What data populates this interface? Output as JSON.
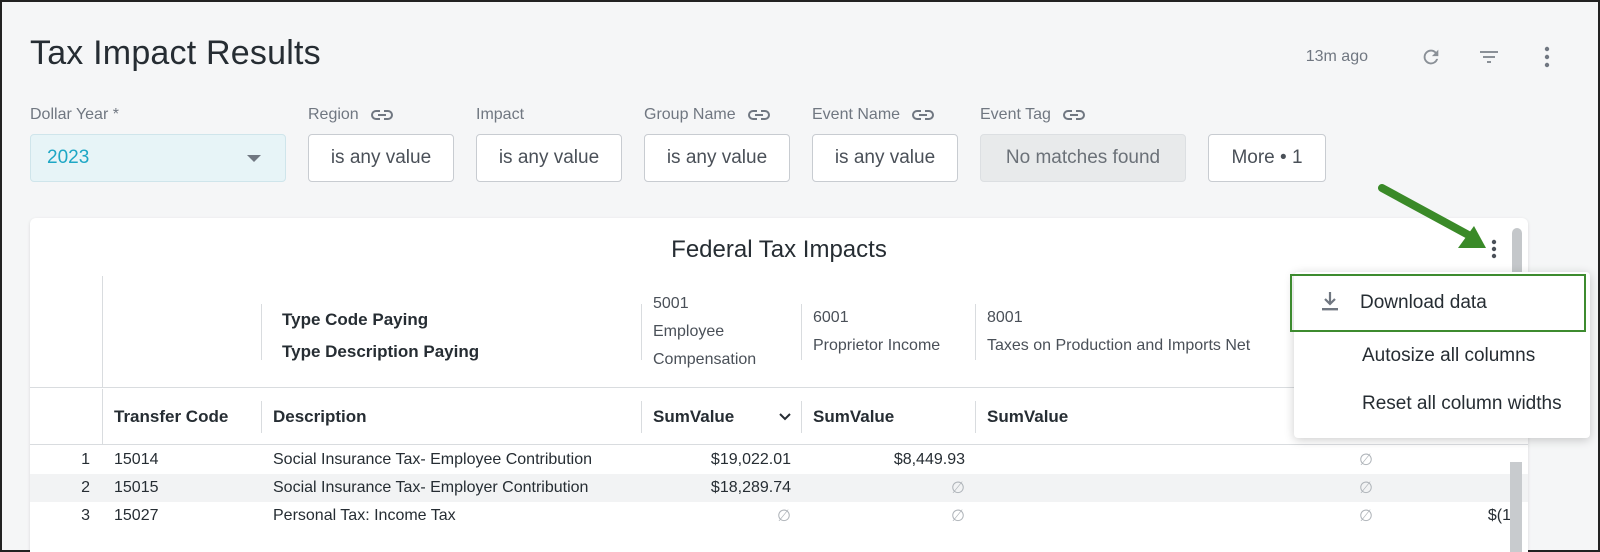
{
  "page": {
    "title": "Tax Impact Results",
    "updated": "13m ago",
    "icons": [
      "refresh-icon",
      "filter-icon",
      "more-vertical-icon"
    ]
  },
  "filters": {
    "dollar_year": {
      "label": "Dollar Year *",
      "value": "2023"
    },
    "region": {
      "label": "Region",
      "value": "is any value"
    },
    "impact": {
      "label": "Impact",
      "value": "is any value"
    },
    "group_name": {
      "label": "Group Name",
      "value": "is any value"
    },
    "event_name": {
      "label": "Event Name",
      "value": "is any value"
    },
    "event_tag": {
      "label": "Event Tag",
      "value": "No matches found"
    },
    "more": {
      "label": "More • 1"
    }
  },
  "card": {
    "title": "Federal Tax Impacts",
    "pivot": {
      "row_label_1": "Type Code Paying",
      "row_label_2": "Type Description Paying",
      "cols": [
        {
          "code": "5001",
          "desc1": "Employee",
          "desc2": "Compensation"
        },
        {
          "code": "6001",
          "desc": "Proprietor Income"
        },
        {
          "code": "8001",
          "desc": "Taxes on Production and Imports Net"
        }
      ]
    },
    "columns": {
      "transfer_code": "Transfer Code",
      "description": "Description",
      "sum1": "SumValue",
      "sum2": "SumValue",
      "sum3": "SumValue"
    },
    "rows": [
      {
        "n": "1",
        "code": "15014",
        "desc": "Social Insurance Tax- Employee Contribution",
        "v1": "$19,022.01",
        "v2": "$8,449.93",
        "v3": "∅",
        "v4": ""
      },
      {
        "n": "2",
        "code": "15015",
        "desc": "Social Insurance Tax- Employer Contribution",
        "v1": "$18,289.74",
        "v2": "∅",
        "v3": "∅",
        "v4": ""
      },
      {
        "n": "3",
        "code": "15027",
        "desc": "Personal Tax: Income Tax",
        "v1": "∅",
        "v2": "∅",
        "v3": "∅",
        "v4": "$(1"
      }
    ]
  },
  "menu": {
    "download": "Download data",
    "autosize": "Autosize all columns",
    "reset": "Reset all column widths"
  },
  "colors": {
    "accent": "#1ea7c5",
    "highlight": "#3d8b2f"
  }
}
